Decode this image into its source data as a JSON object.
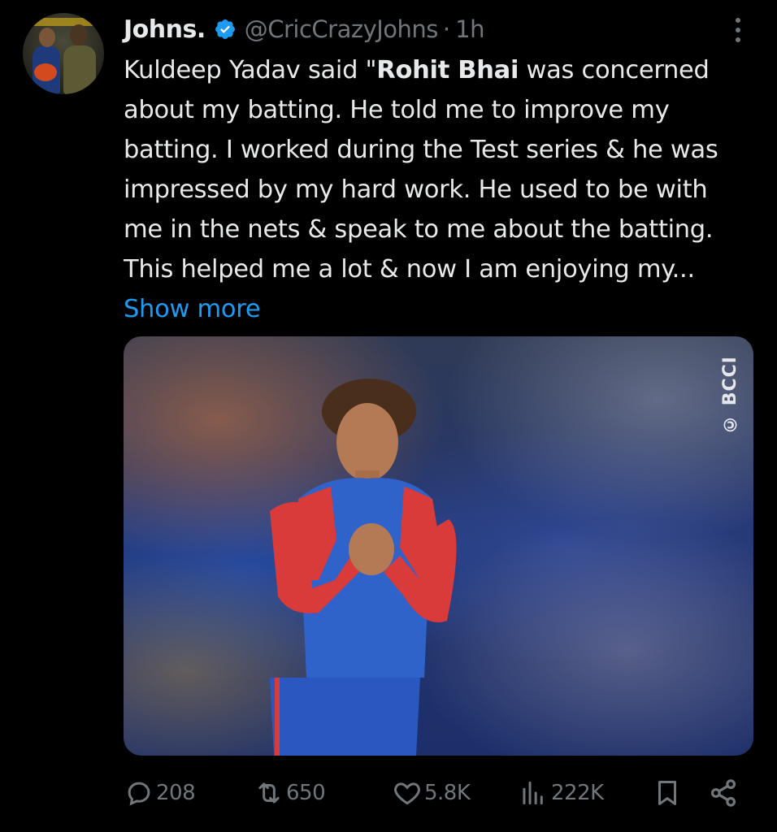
{
  "author": {
    "display_name": "Johns.",
    "handle": "@CricCrazyJohns",
    "separator": "·",
    "time": "1h",
    "verified": true
  },
  "tweet": {
    "text_before": "Kuldeep Yadav said \"",
    "text_bold": "Rohit Bhai",
    "text_after": " was concerned about my batting. He told me to improve my batting. I worked during the Test series & he was impressed by my hard work. He used to be with me in the nets & speak to me about the batting. This helped me a lot & now I am enjoying my...",
    "show_more": "Show more"
  },
  "media": {
    "watermark": "© BCCI"
  },
  "actions": {
    "replies": "208",
    "reposts": "650",
    "likes": "5.8K",
    "views": "222K"
  },
  "colors": {
    "background": "#000000",
    "text": "#e7e9ea",
    "muted": "#71767b",
    "link": "#1d9bf0",
    "verified_badge": "#1d9bf0"
  },
  "icons": {
    "more": "more-vertical-icon",
    "verified": "verified-badge-icon",
    "reply": "reply-icon",
    "repost": "repost-icon",
    "like": "heart-icon",
    "views": "views-icon",
    "bookmark": "bookmark-icon",
    "share": "share-icon"
  }
}
